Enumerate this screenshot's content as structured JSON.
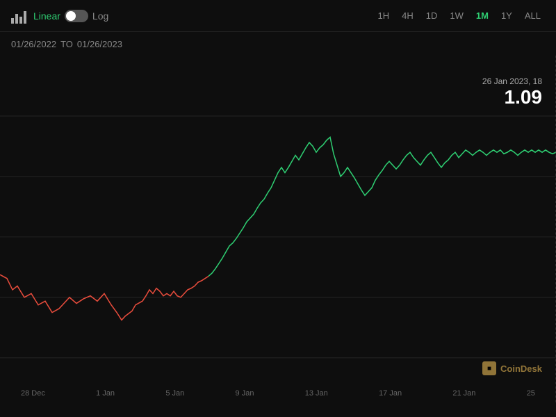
{
  "toolbar": {
    "scale_linear": "Linear",
    "scale_log": "Log",
    "time_periods": [
      "1H",
      "4H",
      "1D",
      "1W",
      "1M",
      "1Y",
      "ALL"
    ],
    "active_period": "1M"
  },
  "date_range": {
    "from": "01/26/2022",
    "to": "01/26/2023",
    "separator": "TO"
  },
  "tooltip": {
    "date": "26 Jan 2023, 18",
    "value": "1.09"
  },
  "x_axis_labels": [
    "28 Dec",
    "1 Jan",
    "5 Jan",
    "9 Jan",
    "13 Jan",
    "17 Jan",
    "21 Jan",
    "25"
  ],
  "watermark": {
    "text": "CoinD"
  },
  "colors": {
    "green": "#2ecc71",
    "red": "#e74c3c",
    "background": "#0e0e0e",
    "grid": "#222222",
    "active_tab": "#2ecc71"
  }
}
